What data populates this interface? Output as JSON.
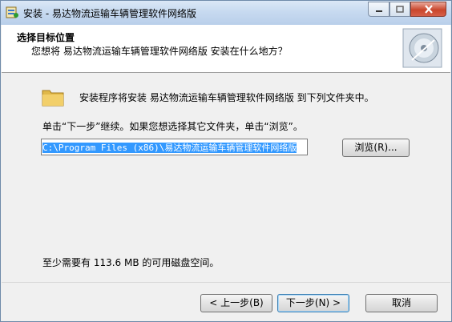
{
  "window": {
    "title": "安装 - 易达物流运输车辆管理软件网络版"
  },
  "header": {
    "title": "选择目标位置",
    "subtitle": "您想将 易达物流运输车辆管理软件网络版 安装在什么地方？"
  },
  "content": {
    "info": "安装程序将安装 易达物流运输车辆管理软件网络版 到下列文件夹中。",
    "instruction": "单击“下一步”继续。如果您想选择其它文件夹，单击“浏览”。",
    "path_value": "C:\\Program Files (x86)\\易达物流运输车辆管理软件网络版",
    "browse_label": "浏览(R)...",
    "space_required": "至少需要有 113.6 MB 的可用磁盘空间。"
  },
  "footer": {
    "back_label": "< 上一步(B)",
    "next_label": "下一步(N) >",
    "cancel_label": "取消"
  },
  "icons": {
    "app": "installer-icon",
    "disc": "cd-disc-icon",
    "folder": "folder-icon"
  },
  "colors": {
    "selection": "#3399ff",
    "titlebar": "#c7daf0"
  }
}
